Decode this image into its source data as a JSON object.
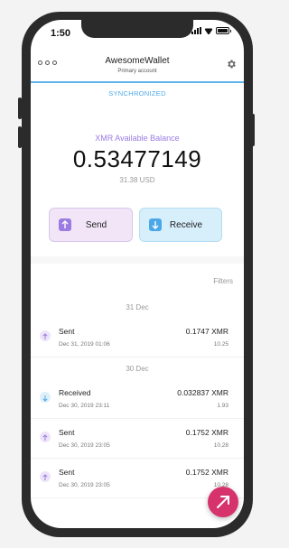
{
  "status_bar": {
    "time": "1:50"
  },
  "header": {
    "wallet_name": "AwesomeWallet",
    "wallet_subtitle": "Primary account",
    "menu_icon": "more-dots-icon",
    "settings_icon": "gear-icon"
  },
  "sync_status": "SYNCHRONIZED",
  "balance": {
    "label": "XMR Available Balance",
    "value": "0.53477149",
    "fiat": "31.38 USD"
  },
  "actions": {
    "send_label": "Send",
    "receive_label": "Receive"
  },
  "filters_label": "Filters",
  "groups": [
    {
      "date": "31 Dec",
      "transactions": [
        {
          "type": "Sent",
          "date": "Dec 31, 2019 01:06",
          "amount": "0.1747 XMR",
          "fiat": "10.25",
          "direction": "out"
        }
      ]
    },
    {
      "date": "30 Dec",
      "transactions": [
        {
          "type": "Received",
          "date": "Dec 30, 2019 23:11",
          "amount": "0.032837 XMR",
          "fiat": "1.93",
          "direction": "in"
        },
        {
          "type": "Sent",
          "date": "Dec 30, 2019 23:05",
          "amount": "0.1752 XMR",
          "fiat": "10.28",
          "direction": "out"
        },
        {
          "type": "Sent",
          "date": "Dec 30, 2019 23:05",
          "amount": "0.1752 XMR",
          "fiat": "10.28",
          "direction": "out"
        }
      ]
    }
  ],
  "colors": {
    "accent_purple": "#9b7be3",
    "accent_blue": "#4aa8e8",
    "fab_pink": "#d6336c"
  }
}
